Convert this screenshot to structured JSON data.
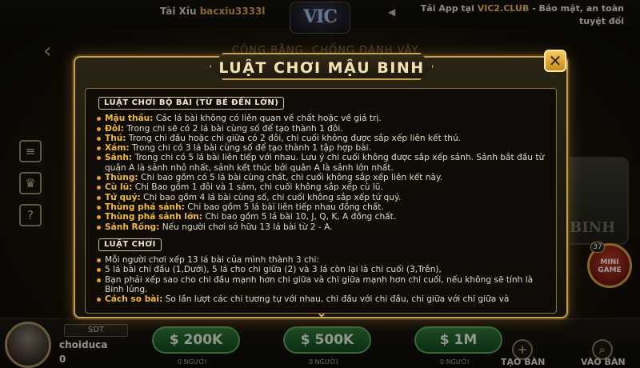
{
  "header": {
    "taixiu_label": "Tài Xỉu",
    "taixiu_user": "bacxiu3333l",
    "logo_text": "VIC",
    "taiapp_prefix": "Tải App tại",
    "taiapp_site": "VIC2.CLUB",
    "taiapp_suffix": "- Bảo mật, an toàn tuyệt đối",
    "slogan": "CÔNG BẰNG, CHỐNG ĐÁNH VÂY"
  },
  "side": {
    "card_label": "BINH",
    "mini_game_line1": "MINI",
    "mini_game_line2": "GAME",
    "mini_badge": "37"
  },
  "modal": {
    "title": "LUẬT CHƠI MẬU BINH",
    "close_glyph": "✕",
    "section1_title": "LUẬT CHƠI BỘ BÀI (TỪ BÉ ĐẾN LỚN)",
    "rules1": [
      {
        "term": "Mậu thầu:",
        "text": "Các lá bài không có liên quan về chất hoặc về giá trị."
      },
      {
        "term": "Đôi:",
        "text": "Trong chi sẽ có 2 lá bài cùng số để tạo thành 1 đôi."
      },
      {
        "term": "Thú:",
        "text": "Trong chi đầu hoặc chi giữa có 2 đôi, chi cuối không được sắp xếp liên kết thú."
      },
      {
        "term": "Xám:",
        "text": "Trong chi có 3 lá bài cùng số để tạo thành 1 tập hợp bài."
      },
      {
        "term": "Sảnh:",
        "text": "Trong chi có 5 lá bài liên tiếp với nhau. Lưu ý chi cuối không được sắp xếp sảnh. Sảnh bắt đầu từ quân A là sảnh nhỏ nhất, sảnh kết thúc bởi quân A là sảnh lớn nhất."
      },
      {
        "term": "Thùng:",
        "text": "Chi bao gồm có 5 lá bài cùng chất, chi cuối không sắp xếp liên kết này."
      },
      {
        "term": "Cù lũ:",
        "text": "Chi Bao gồm 1 đôi và 1 sám, chi cuối không sắp xếp cù lũ."
      },
      {
        "term": "Tứ quý:",
        "text": "Chi bao gồm 4 lá bài cùng số, chi cuối không sắp xếp tứ quý."
      },
      {
        "term": "Thùng phá sảnh:",
        "text": "Chi bao gồm 5 lá bài liên tiếp nhau đồng chất."
      },
      {
        "term": "Thùng phá sảnh lớn:",
        "text": "Chi bao gồm 5 lá bài 10, J, Q, K, A đồng chất."
      },
      {
        "term": "Sảnh Rồng:",
        "text": "Nếu người chơi sở hữu 13 lá bài từ 2 - A."
      }
    ],
    "section2_title": "LUẬT CHƠI",
    "rules2": [
      {
        "term": "",
        "text": "Mỗi người chơi xếp 13 lá bài của mình thành 3 chi:"
      },
      {
        "term": "",
        "text": "5 lá bài chi đầu (1,Dưới), 5 lá cho chi giữa (2) và 3 lá còn lại là chi cuối (3,Trên),"
      },
      {
        "term": "",
        "text": "Bạn phải xếp sao cho chi đầu mạnh hơn chi giữa và chi giữa mạnh hơn chi cuối, nếu không sẽ tính là Binh lủng."
      },
      {
        "term": "Cách so bài:",
        "text": "So lần lượt các chi tương tự với nhau, chi đầu với chi đầu, chi giữa với chi giữa và"
      }
    ],
    "scroll_glyph": "⌄"
  },
  "bottom": {
    "sdt_label": "SDT",
    "username": "choiduca",
    "balance": "0",
    "bets": [
      "$ 200K",
      "$ 500K",
      "$ 1M"
    ],
    "bet_sub": "0 NGƯỜI",
    "create_room_label": "TẠO BÀN",
    "join_room_label": "VÀO BÀN"
  }
}
